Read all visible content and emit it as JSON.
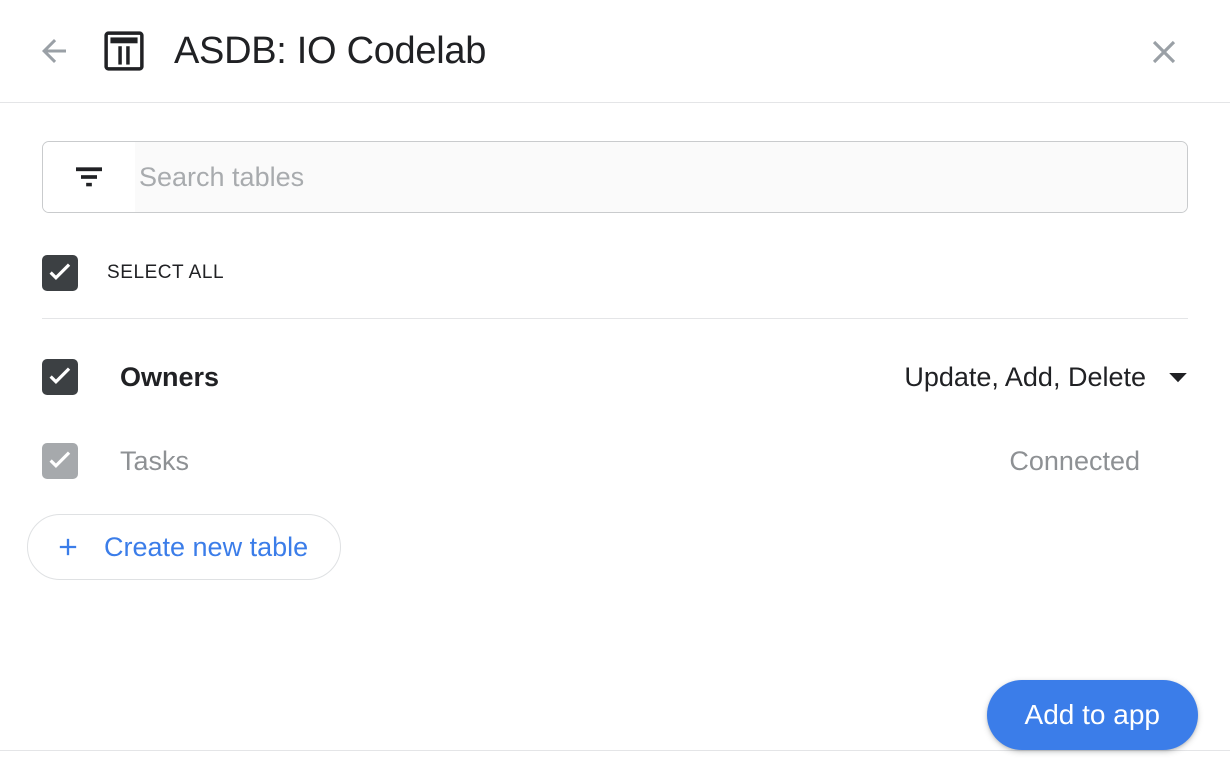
{
  "header": {
    "back_icon": "back-arrow-icon",
    "app_icon": "table-icon",
    "title": "ASDB: IO Codelab",
    "close_icon": "close-icon"
  },
  "search": {
    "filter_icon": "filter-icon",
    "placeholder": "Search tables",
    "value": ""
  },
  "select_all": {
    "label": "SELECT ALL",
    "checked": true
  },
  "tables": [
    {
      "name": "Owners",
      "checked": true,
      "enabled": true,
      "permissions": "Update, Add, Delete",
      "caret_icon": "chevron-down-icon"
    },
    {
      "name": "Tasks",
      "checked": true,
      "enabled": false,
      "status": "Connected"
    }
  ],
  "create_table": {
    "label": "Create new table",
    "icon": "plus-icon"
  },
  "footer": {
    "primary_label": "Add to app"
  },
  "colors": {
    "accent": "#3b7de9",
    "checkbox": "#3c4043",
    "checkbox_disabled": "#a6a9ac",
    "text": "#202124",
    "muted": "#8e9194",
    "divider": "#e4e5e7"
  }
}
